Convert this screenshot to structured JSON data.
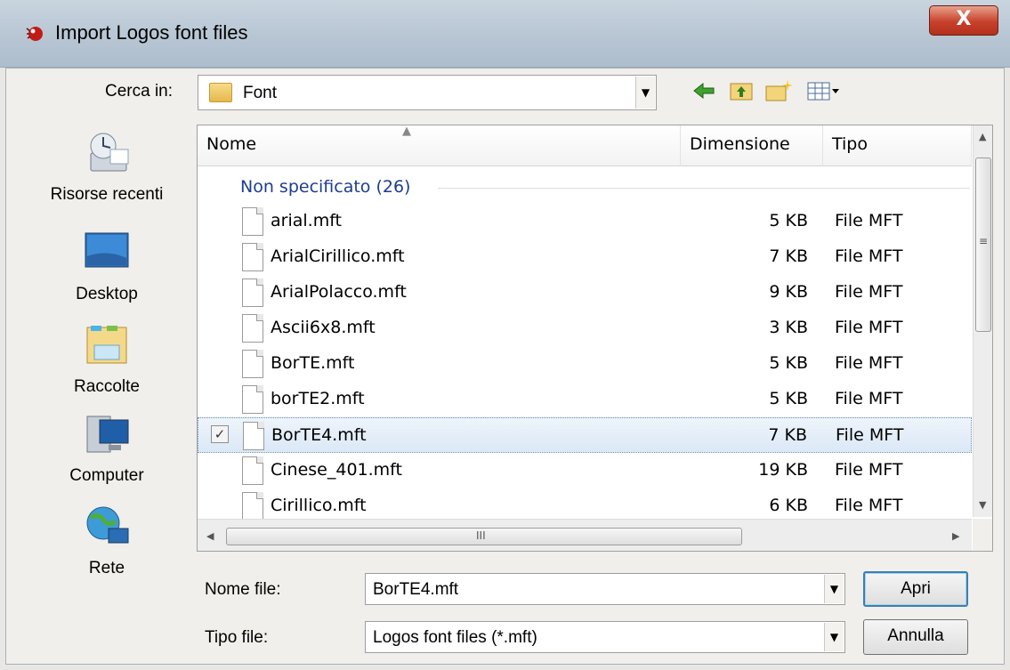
{
  "window": {
    "title": "Import Logos font files",
    "close_glyph": "X"
  },
  "toolbar": {
    "lookin_label": "Cerca in:",
    "lookin_value": "Font",
    "back_icon": "back-arrow-icon",
    "up_icon": "up-folder-icon",
    "newfolder_icon": "new-folder-icon",
    "views_icon": "view-menu-icon"
  },
  "places": [
    {
      "label": "Risorse recenti",
      "icon": "recent-places-icon"
    },
    {
      "label": "Desktop",
      "icon": "desktop-icon"
    },
    {
      "label": "Raccolte",
      "icon": "libraries-icon"
    },
    {
      "label": "Computer",
      "icon": "computer-icon"
    },
    {
      "label": "Rete",
      "icon": "network-icon"
    }
  ],
  "list": {
    "columns": {
      "name": "Nome",
      "size": "Dimensione",
      "type": "Tipo"
    },
    "group": "Non specificato (26)",
    "files": [
      {
        "name": "arial.mft",
        "size": "5 KB",
        "type": "File MFT"
      },
      {
        "name": "ArialCirillico.mft",
        "size": "7 KB",
        "type": "File MFT"
      },
      {
        "name": "ArialPolacco.mft",
        "size": "9 KB",
        "type": "File MFT"
      },
      {
        "name": "Ascii6x8.mft",
        "size": "3 KB",
        "type": "File MFT"
      },
      {
        "name": "BorTE.mft",
        "size": "5 KB",
        "type": "File MFT"
      },
      {
        "name": "borTE2.mft",
        "size": "5 KB",
        "type": "File MFT"
      },
      {
        "name": "BorTE4.mft",
        "size": "7 KB",
        "type": "File MFT",
        "selected": true
      },
      {
        "name": "Cinese_401.mft",
        "size": "19 KB",
        "type": "File MFT"
      },
      {
        "name": "Cirillico.mft",
        "size": "6 KB",
        "type": "File MFT"
      }
    ],
    "hscroll_grip": "III"
  },
  "form": {
    "filename_label": "Nome file:",
    "filename_value": "BorTE4.mft",
    "filetype_label": "Tipo file:",
    "filetype_value": "Logos font files (*.mft)",
    "open_label": "Apri",
    "cancel_label": "Annulla"
  },
  "colors": {
    "group_header": "#1e3d8f",
    "selection": "#dbe8f6",
    "close_button": "#c7412b"
  }
}
